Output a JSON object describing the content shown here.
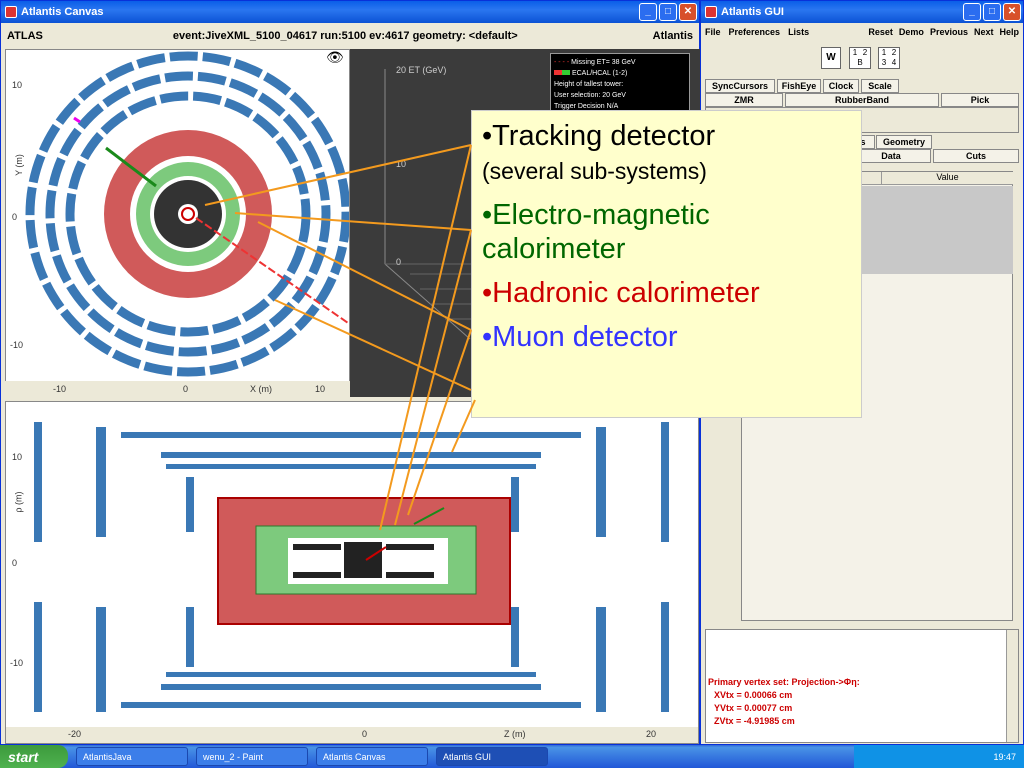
{
  "canvas": {
    "title": "Atlantis Canvas",
    "left_label": "ATLAS",
    "event_info": "event:JiveXML_5100_04617 run:5100 ev:4617  geometry: <default>",
    "right_label": "Atlantis",
    "yx": {
      "ylabel": "Y (m)",
      "xlabel": "X (m)",
      "xticks": [
        "-10",
        "0",
        "10"
      ],
      "yticks": [
        "10",
        "0",
        "-10"
      ]
    },
    "legend": [
      "Missing ET= 38 GeV",
      "ECAL/HCAL (1-2)",
      "Height of tallest tower:",
      "User selection: 20 GeV",
      "Trigger Decision N/A"
    ],
    "lego_tick": "20 ET (GeV)",
    "lego_mid": "10",
    "lego_zero": "0",
    "rz": {
      "ylabel": "ρ (m)",
      "xlabel": "Z (m)",
      "xticks": [
        "-20",
        "0",
        "20"
      ],
      "yticks": [
        "10",
        "0",
        "-10"
      ]
    }
  },
  "gui": {
    "title": "Atlantis GUI",
    "menu": [
      "File",
      "Preferences",
      "Lists"
    ],
    "menu_right": [
      "Reset",
      "Demo",
      "Previous",
      "Next",
      "Help"
    ],
    "layout_w": "W",
    "layout_grid1": [
      "1",
      "2",
      "B"
    ],
    "layout_grid2": [
      "1",
      "2",
      "3",
      "4"
    ],
    "tabs_top": [
      "SyncCursors",
      "FishEye",
      "Clock",
      "Scale"
    ],
    "tabs_row2": [
      "ZMR",
      "RubberBand",
      "Pick"
    ],
    "tabs_mid": [
      "s",
      "Geometry"
    ],
    "tabs_mid2": [
      "Data",
      "Cuts"
    ],
    "table_header": "Value",
    "output": [
      "Primary vertex set: Projection->Φη:",
      "XVtx = 0.00066 cm",
      "YVtx = 0.00077 cm",
      "ZVtx = -4.91985 cm"
    ]
  },
  "callout": {
    "item1": "•Tracking detector",
    "item1_sub": "(several sub-systems)",
    "item2": "•Electro-magnetic calorimeter",
    "item3": "•Hadronic calorimeter",
    "item4": "•Muon detector",
    "colors": {
      "item1": "#000000",
      "item2": "#006600",
      "item3": "#cc0000",
      "item4": "#3333ff"
    }
  },
  "taskbar": {
    "start": "start",
    "items": [
      "AtlantisJava",
      "wenu_2 - Paint",
      "Atlantis Canvas",
      "Atlantis GUI"
    ],
    "time": "19:47"
  }
}
